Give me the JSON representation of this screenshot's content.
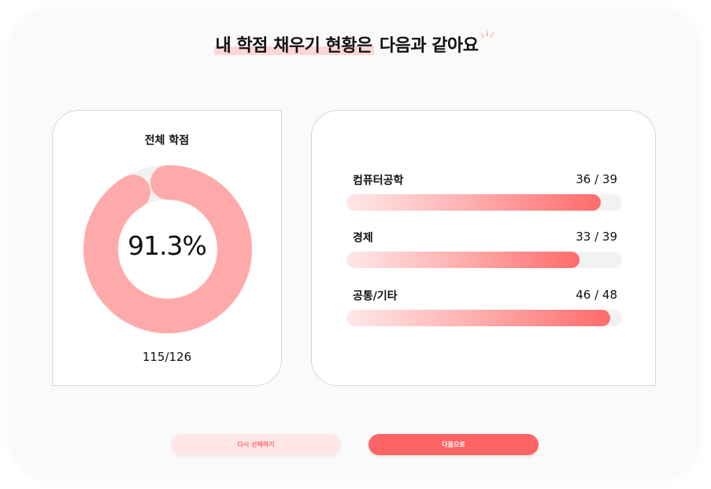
{
  "header": {
    "title_highlight": "내 학점 채우기 현황은",
    "title_rest": " 다음과 같아요"
  },
  "summary": {
    "label": "전체 학점",
    "percent_text": "91.3%",
    "fraction_text": "115/126",
    "progress": 0.913,
    "ring_color": "#ffaaaa",
    "track_color": "#f1f1f1"
  },
  "subjects": [
    {
      "name": "컴퓨터공학",
      "count_text": "36 / 39",
      "earned": 36,
      "required": 39
    },
    {
      "name": "경제",
      "count_text": "33 / 39",
      "earned": 33,
      "required": 39
    },
    {
      "name": "공통/기타",
      "count_text": "46 / 48",
      "earned": 46,
      "required": 48
    }
  ],
  "actions": {
    "reselect_label": "다시 선택하기",
    "next_label": "다음으로"
  },
  "colors": {
    "accent": "#ff6464",
    "highlight": "#ffd6d6"
  }
}
